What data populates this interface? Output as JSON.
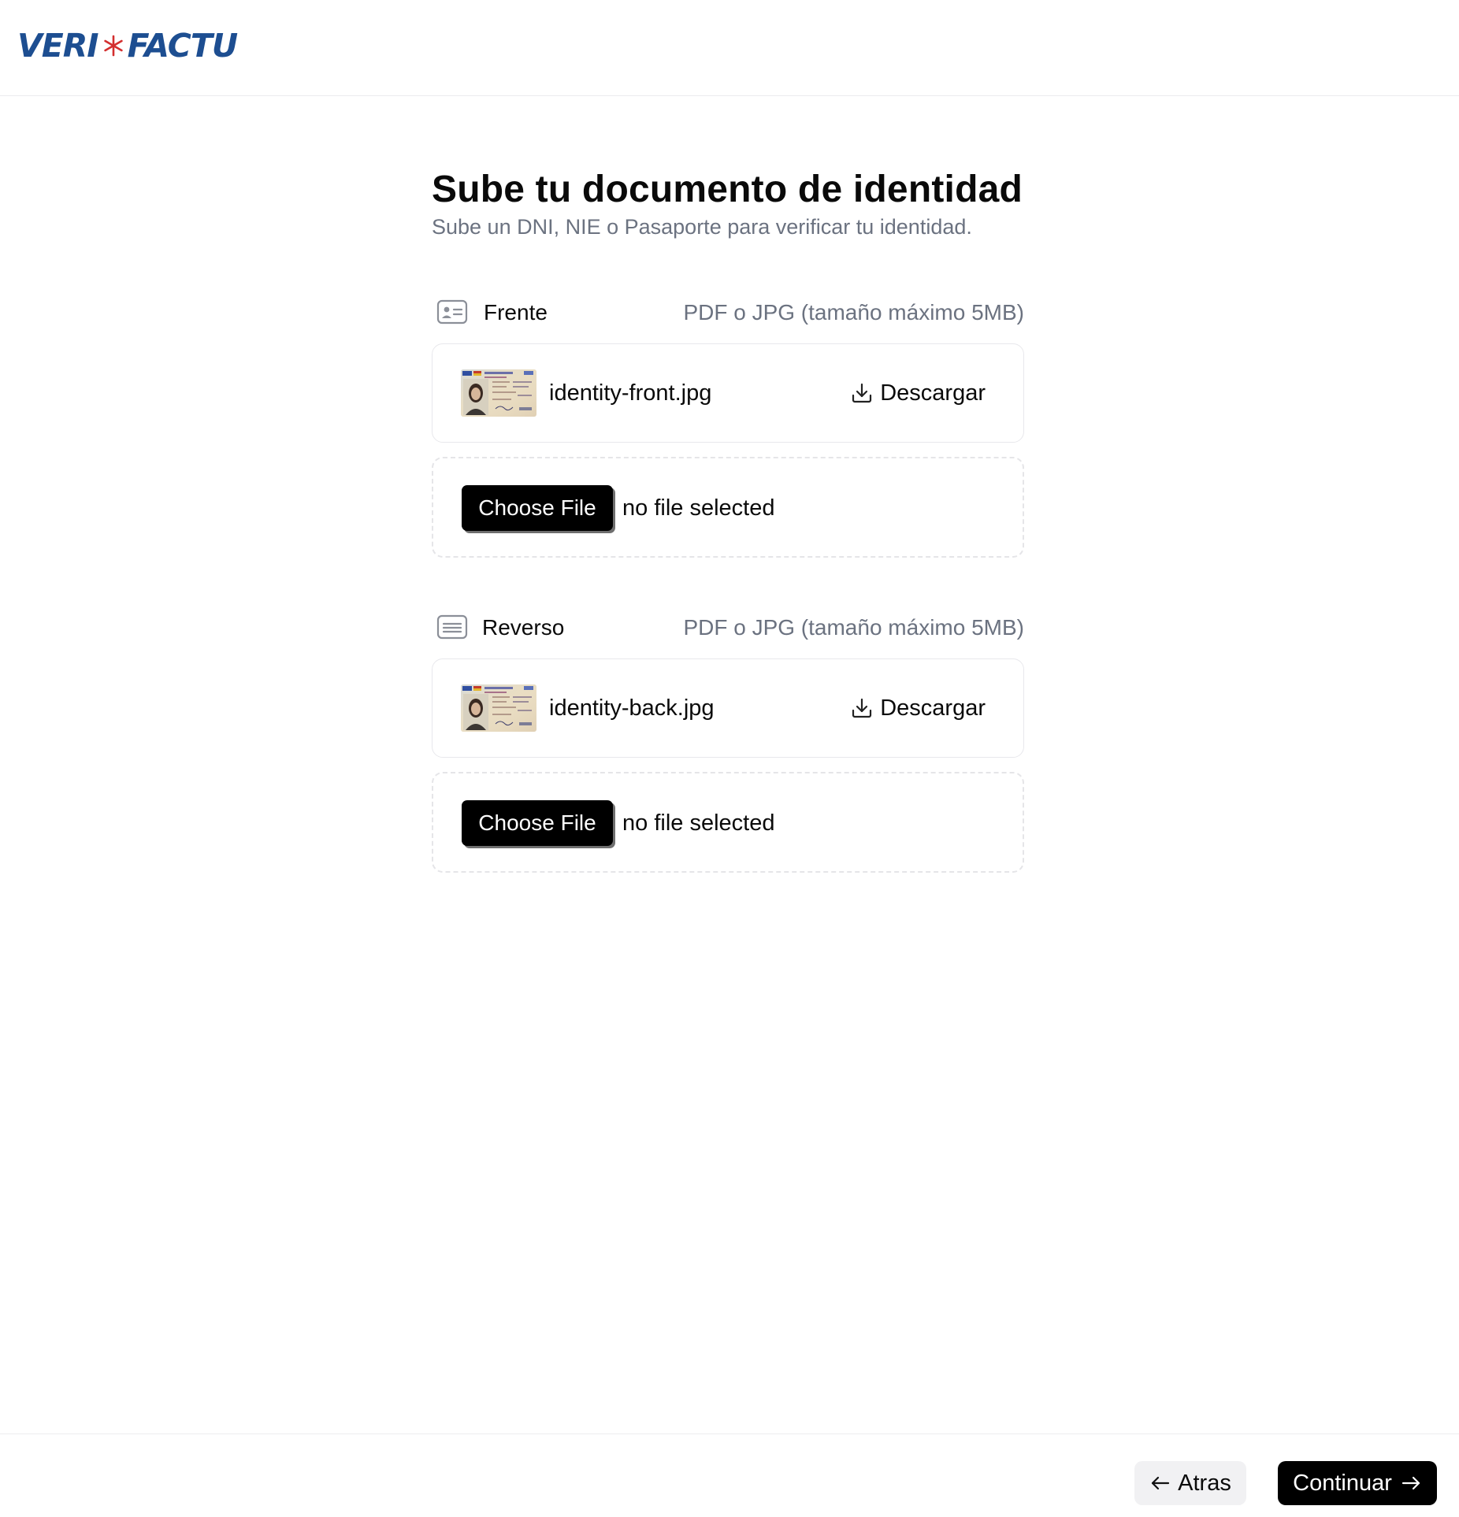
{
  "brand": {
    "logo_left": "VERI",
    "logo_right": "FACTU",
    "primary_color": "#1d4e91",
    "accent_color": "#d32f2f"
  },
  "page": {
    "title": "Sube tu documento de identidad",
    "subtitle": "Sube un DNI, NIE o Pasaporte para verificar tu identidad."
  },
  "front": {
    "icon": "id-card-icon",
    "label": "Frente",
    "hint": "PDF o JPG (tamaño máximo 5MB)",
    "file_name": "identity-front.jpg",
    "download_label": "Descargar",
    "choose_label": "Choose File",
    "no_file_label": "no file selected"
  },
  "back": {
    "icon": "id-card-back-icon",
    "label": "Reverso",
    "hint": "PDF o JPG (tamaño máximo 5MB)",
    "file_name": "identity-back.jpg",
    "download_label": "Descargar",
    "choose_label": "Choose File",
    "no_file_label": "no file selected"
  },
  "footer": {
    "back_label": "Atras",
    "next_label": "Continuar"
  }
}
